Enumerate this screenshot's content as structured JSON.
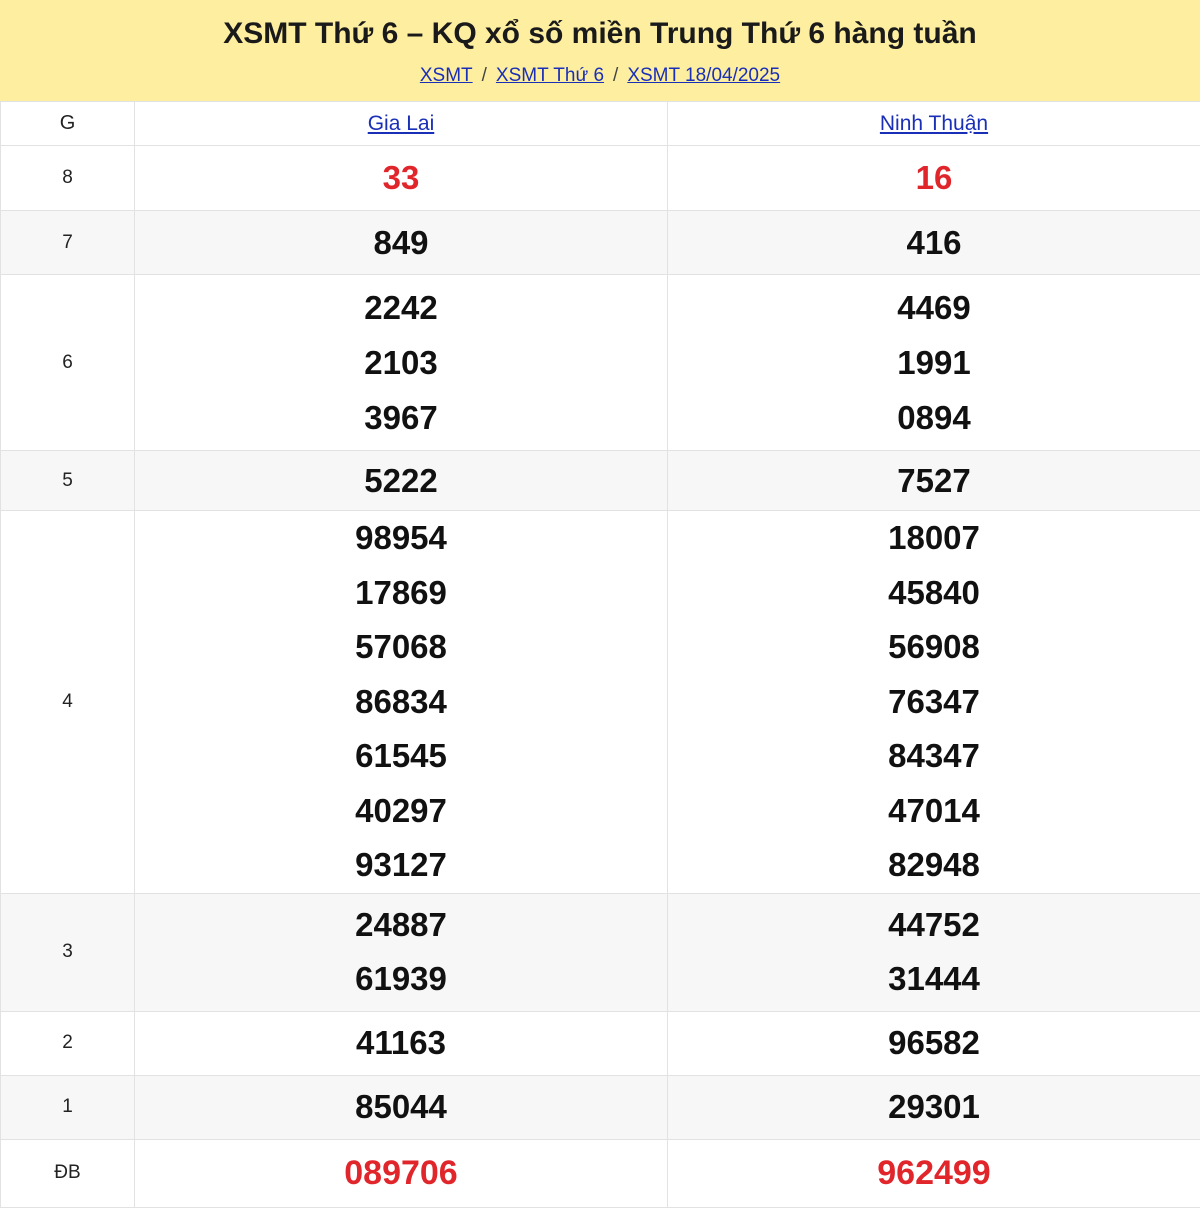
{
  "header": {
    "title": "XSMT Thứ 6 – KQ xổ số miền Trung Thứ 6 hàng tuần",
    "breadcrumb": [
      "XSMT",
      "XSMT Thứ 6",
      "XSMT 18/04/2025"
    ],
    "separator": "/"
  },
  "table": {
    "col_label": "G",
    "provinces": [
      "Gia Lai",
      "Ninh Thuận"
    ],
    "prizes": [
      {
        "label": "8",
        "gia_lai": [
          "33"
        ],
        "ninh_thuan": [
          "16"
        ]
      },
      {
        "label": "7",
        "gia_lai": [
          "849"
        ],
        "ninh_thuan": [
          "416"
        ]
      },
      {
        "label": "6",
        "gia_lai": [
          "2242",
          "2103",
          "3967"
        ],
        "ninh_thuan": [
          "4469",
          "1991",
          "0894"
        ]
      },
      {
        "label": "5",
        "gia_lai": [
          "5222"
        ],
        "ninh_thuan": [
          "7527"
        ]
      },
      {
        "label": "4",
        "gia_lai": [
          "98954",
          "17869",
          "57068",
          "86834",
          "61545",
          "40297",
          "93127"
        ],
        "ninh_thuan": [
          "18007",
          "45840",
          "56908",
          "76347",
          "84347",
          "47014",
          "82948"
        ]
      },
      {
        "label": "3",
        "gia_lai": [
          "24887",
          "61939"
        ],
        "ninh_thuan": [
          "44752",
          "31444"
        ]
      },
      {
        "label": "2",
        "gia_lai": [
          "41163"
        ],
        "ninh_thuan": [
          "96582"
        ]
      },
      {
        "label": "1",
        "gia_lai": [
          "85044"
        ],
        "ninh_thuan": [
          "29301"
        ]
      },
      {
        "label": "ĐB",
        "gia_lai": [
          "089706"
        ],
        "ninh_thuan": [
          "962499"
        ]
      }
    ]
  },
  "colors": {
    "header_bg": "#fdeea0",
    "link": "#1a2fb8",
    "highlight_red": "#e0252b",
    "alt_row": "#f7f7f7"
  }
}
